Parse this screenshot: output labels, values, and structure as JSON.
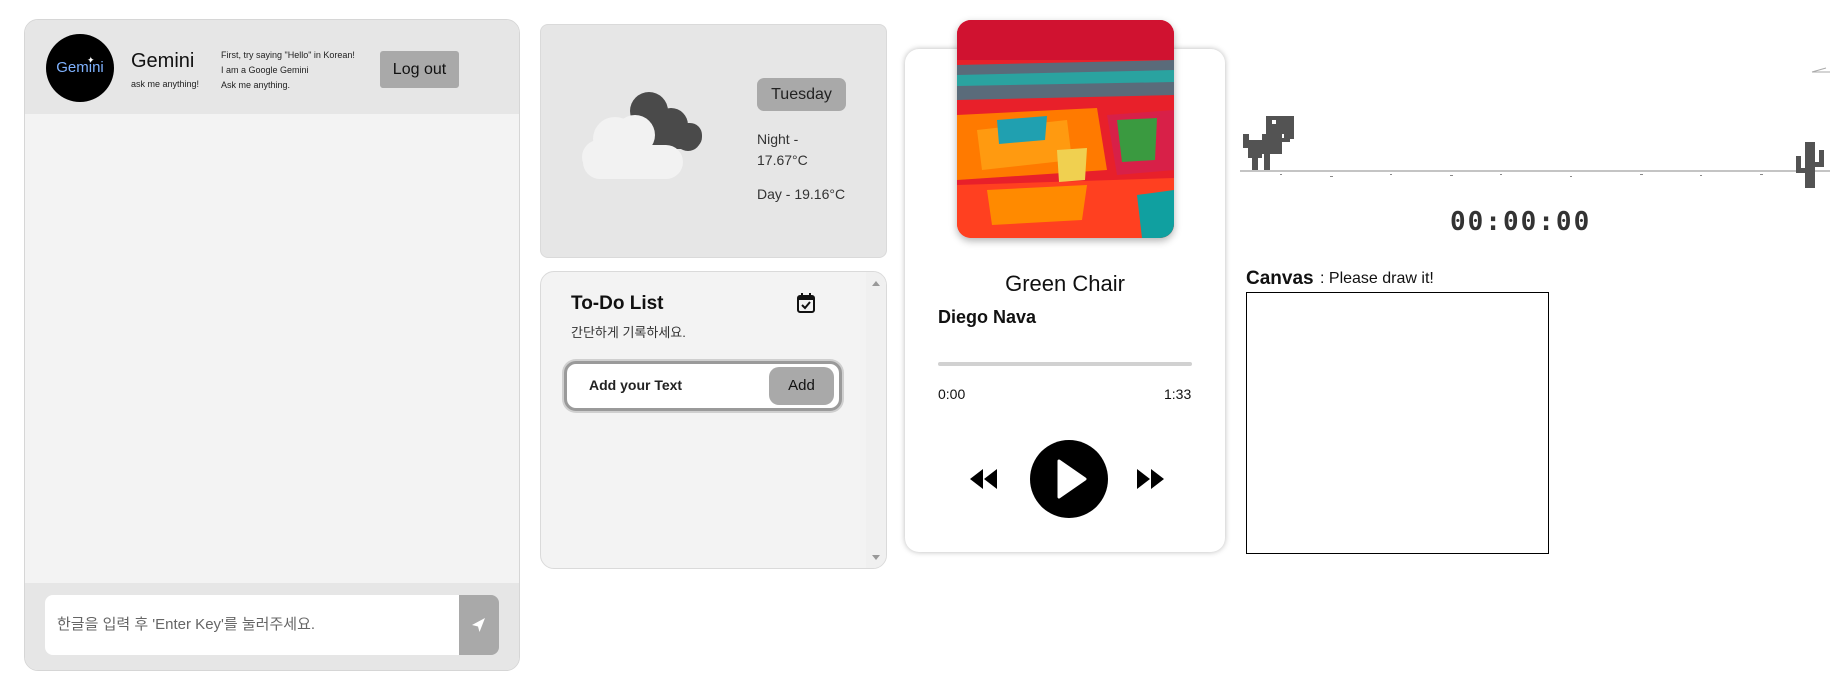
{
  "chat": {
    "logo_text": "Gemini",
    "name": "Gemini",
    "tagline": "ask me anything!",
    "notes": [
      "First, try saying \"Hello\" in Korean!",
      "I am a Google Gemini",
      "Ask me anything."
    ],
    "logout_label": "Log out",
    "input_placeholder": "한글을 입력 후 'Enter Key'를 눌러주세요.",
    "send_icon": "send-icon"
  },
  "weather": {
    "day": "Tuesday",
    "night": "Night - 17.67°C",
    "day_temp": "Day - 19.16°C",
    "icon": "cloud-icon"
  },
  "todo": {
    "title": "To-Do List",
    "subtitle": "간단하게 기록하세요.",
    "input_placeholder": "Add your Text",
    "add_label": "Add",
    "icon": "calendar-check-icon"
  },
  "player": {
    "title": "Green Chair",
    "artist": "Diego Nava",
    "current_time": "0:00",
    "duration": "1:33",
    "progress_fraction": 0
  },
  "dino": {
    "timer": "00:00:00"
  },
  "canvas": {
    "title": "Canvas",
    "hint": ": Please draw it!"
  },
  "colors": {
    "panel": "#f3f3f3",
    "header": "#e6e6e6",
    "button": "#a9a9a9",
    "dino": "#535353"
  }
}
